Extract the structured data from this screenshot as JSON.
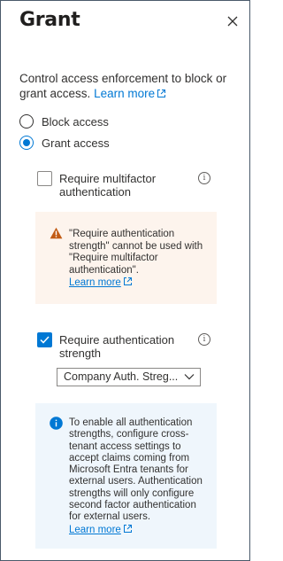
{
  "panel": {
    "title": "Grant",
    "description": "Control access enforcement to block or grant access.",
    "learn_more": "Learn more"
  },
  "radios": [
    {
      "label": "Block access",
      "selected": false
    },
    {
      "label": "Grant access",
      "selected": true
    }
  ],
  "mfa": {
    "label": "Require multifactor authentication",
    "checked": false
  },
  "warning": {
    "text": "\"Require authentication strength\" cannot be used with \"Require multifactor authentication\".",
    "learn_more": "Learn more"
  },
  "auth_strength": {
    "label": "Require authentication strength",
    "checked": true,
    "selected_value": "Company Auth. Streg..."
  },
  "info": {
    "text": "To enable all authentication strengths, configure cross-tenant access settings to accept claims coming from Microsoft Entra tenants for external users. Authentication strengths will only configure second factor authentication for external users.",
    "learn_more": "Learn more"
  },
  "colors": {
    "accent": "#0078d4",
    "warning_bg": "#fdf4ed",
    "warning_icon": "#c25b14",
    "info_bg": "#eff6fc"
  }
}
